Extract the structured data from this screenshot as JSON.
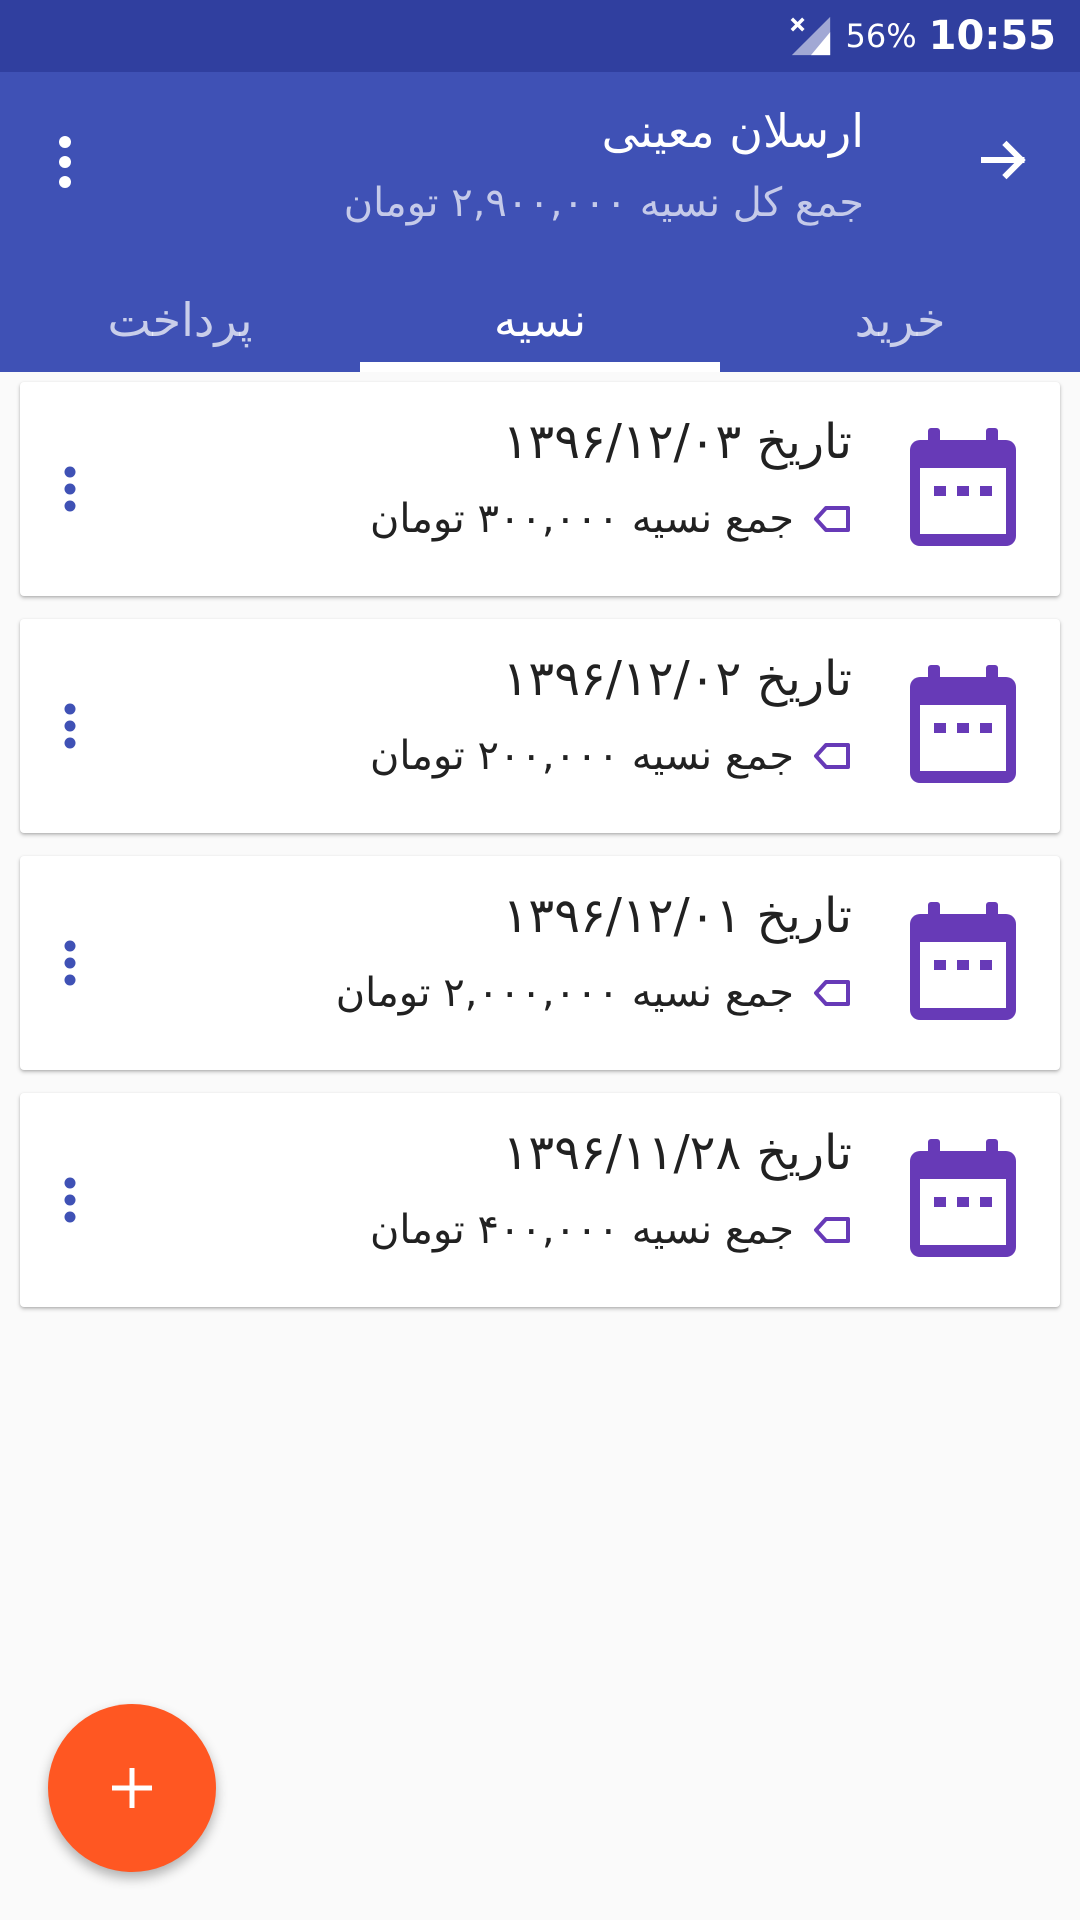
{
  "status_bar": {
    "battery": "56%",
    "time": "10:55",
    "icons": [
      "signal-off-icon"
    ]
  },
  "app_bar": {
    "title": "ارسلان معینی",
    "subtitle": "جمع کل نسیه ۲,۹۰۰,۰۰۰ تومان",
    "icons": [
      "arrow-back-icon",
      "more-vert-icon"
    ]
  },
  "tabs": [
    {
      "label": "خرید",
      "active": false
    },
    {
      "label": "نسیه",
      "active": true
    },
    {
      "label": "پرداخت",
      "active": false
    }
  ],
  "entries": [
    {
      "date": "تاریخ ۱۳۹۶/۱۲/۰۳",
      "sum": "جمع نسیه ۳۰۰,۰۰۰ تومان"
    },
    {
      "date": "تاریخ ۱۳۹۶/۱۲/۰۲",
      "sum": "جمع نسیه ۲۰۰,۰۰۰ تومان"
    },
    {
      "date": "تاریخ ۱۳۹۶/۱۲/۰۱",
      "sum": "جمع نسیه ۲,۰۰۰,۰۰۰ تومان"
    },
    {
      "date": "تاریخ ۱۳۹۶/۱۱/۲۸",
      "sum": "جمع نسیه ۴۰۰,۰۰۰ تومان"
    }
  ],
  "colors": {
    "status_bar": "#303f9f",
    "primary": "#3f51b5",
    "accent_icon": "#673ab7",
    "menu_dots": "#3f51b5",
    "fab": "#ff5722"
  },
  "fab": {
    "icon": "plus-icon"
  }
}
